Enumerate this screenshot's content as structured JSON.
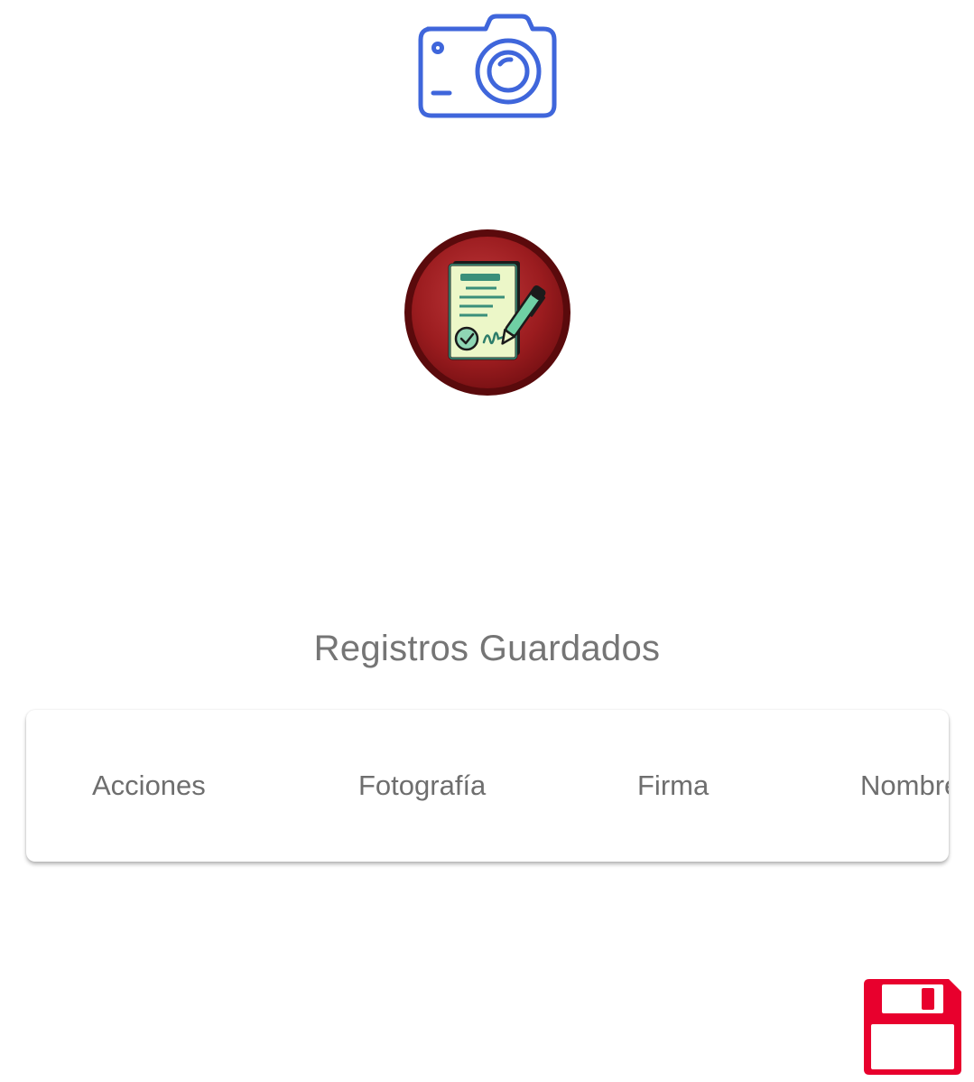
{
  "actions": {
    "camera_icon": "camera-icon",
    "signature_icon": "signature-document-icon",
    "save_icon": "floppy-disk-icon"
  },
  "records": {
    "title": "Registros Guardados",
    "columns": [
      "Acciones",
      "Fotografía",
      "Firma",
      "Nombre"
    ]
  },
  "colors": {
    "camera_stroke": "#3f66db",
    "signature_circle": "#9b1c1f",
    "save_icon": "#e8002d",
    "text_gray": "#757575"
  }
}
